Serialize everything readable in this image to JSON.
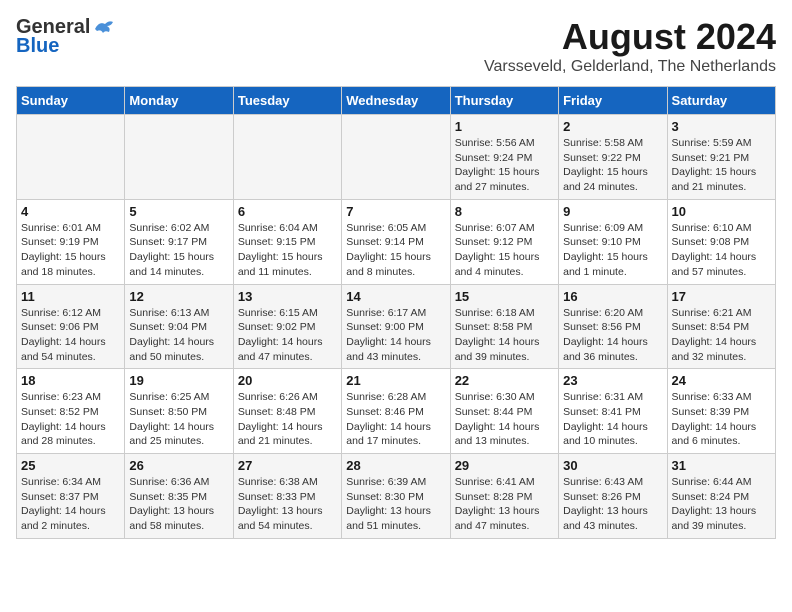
{
  "logo": {
    "general": "General",
    "blue": "Blue"
  },
  "title": "August 2024",
  "subtitle": "Varsseveld, Gelderland, The Netherlands",
  "days_of_week": [
    "Sunday",
    "Monday",
    "Tuesday",
    "Wednesday",
    "Thursday",
    "Friday",
    "Saturday"
  ],
  "weeks": [
    [
      {
        "day": "",
        "info": ""
      },
      {
        "day": "",
        "info": ""
      },
      {
        "day": "",
        "info": ""
      },
      {
        "day": "",
        "info": ""
      },
      {
        "day": "1",
        "info": "Sunrise: 5:56 AM\nSunset: 9:24 PM\nDaylight: 15 hours and 27 minutes."
      },
      {
        "day": "2",
        "info": "Sunrise: 5:58 AM\nSunset: 9:22 PM\nDaylight: 15 hours and 24 minutes."
      },
      {
        "day": "3",
        "info": "Sunrise: 5:59 AM\nSunset: 9:21 PM\nDaylight: 15 hours and 21 minutes."
      }
    ],
    [
      {
        "day": "4",
        "info": "Sunrise: 6:01 AM\nSunset: 9:19 PM\nDaylight: 15 hours and 18 minutes."
      },
      {
        "day": "5",
        "info": "Sunrise: 6:02 AM\nSunset: 9:17 PM\nDaylight: 15 hours and 14 minutes."
      },
      {
        "day": "6",
        "info": "Sunrise: 6:04 AM\nSunset: 9:15 PM\nDaylight: 15 hours and 11 minutes."
      },
      {
        "day": "7",
        "info": "Sunrise: 6:05 AM\nSunset: 9:14 PM\nDaylight: 15 hours and 8 minutes."
      },
      {
        "day": "8",
        "info": "Sunrise: 6:07 AM\nSunset: 9:12 PM\nDaylight: 15 hours and 4 minutes."
      },
      {
        "day": "9",
        "info": "Sunrise: 6:09 AM\nSunset: 9:10 PM\nDaylight: 15 hours and 1 minute."
      },
      {
        "day": "10",
        "info": "Sunrise: 6:10 AM\nSunset: 9:08 PM\nDaylight: 14 hours and 57 minutes."
      }
    ],
    [
      {
        "day": "11",
        "info": "Sunrise: 6:12 AM\nSunset: 9:06 PM\nDaylight: 14 hours and 54 minutes."
      },
      {
        "day": "12",
        "info": "Sunrise: 6:13 AM\nSunset: 9:04 PM\nDaylight: 14 hours and 50 minutes."
      },
      {
        "day": "13",
        "info": "Sunrise: 6:15 AM\nSunset: 9:02 PM\nDaylight: 14 hours and 47 minutes."
      },
      {
        "day": "14",
        "info": "Sunrise: 6:17 AM\nSunset: 9:00 PM\nDaylight: 14 hours and 43 minutes."
      },
      {
        "day": "15",
        "info": "Sunrise: 6:18 AM\nSunset: 8:58 PM\nDaylight: 14 hours and 39 minutes."
      },
      {
        "day": "16",
        "info": "Sunrise: 6:20 AM\nSunset: 8:56 PM\nDaylight: 14 hours and 36 minutes."
      },
      {
        "day": "17",
        "info": "Sunrise: 6:21 AM\nSunset: 8:54 PM\nDaylight: 14 hours and 32 minutes."
      }
    ],
    [
      {
        "day": "18",
        "info": "Sunrise: 6:23 AM\nSunset: 8:52 PM\nDaylight: 14 hours and 28 minutes."
      },
      {
        "day": "19",
        "info": "Sunrise: 6:25 AM\nSunset: 8:50 PM\nDaylight: 14 hours and 25 minutes."
      },
      {
        "day": "20",
        "info": "Sunrise: 6:26 AM\nSunset: 8:48 PM\nDaylight: 14 hours and 21 minutes."
      },
      {
        "day": "21",
        "info": "Sunrise: 6:28 AM\nSunset: 8:46 PM\nDaylight: 14 hours and 17 minutes."
      },
      {
        "day": "22",
        "info": "Sunrise: 6:30 AM\nSunset: 8:44 PM\nDaylight: 14 hours and 13 minutes."
      },
      {
        "day": "23",
        "info": "Sunrise: 6:31 AM\nSunset: 8:41 PM\nDaylight: 14 hours and 10 minutes."
      },
      {
        "day": "24",
        "info": "Sunrise: 6:33 AM\nSunset: 8:39 PM\nDaylight: 14 hours and 6 minutes."
      }
    ],
    [
      {
        "day": "25",
        "info": "Sunrise: 6:34 AM\nSunset: 8:37 PM\nDaylight: 14 hours and 2 minutes."
      },
      {
        "day": "26",
        "info": "Sunrise: 6:36 AM\nSunset: 8:35 PM\nDaylight: 13 hours and 58 minutes."
      },
      {
        "day": "27",
        "info": "Sunrise: 6:38 AM\nSunset: 8:33 PM\nDaylight: 13 hours and 54 minutes."
      },
      {
        "day": "28",
        "info": "Sunrise: 6:39 AM\nSunset: 8:30 PM\nDaylight: 13 hours and 51 minutes."
      },
      {
        "day": "29",
        "info": "Sunrise: 6:41 AM\nSunset: 8:28 PM\nDaylight: 13 hours and 47 minutes."
      },
      {
        "day": "30",
        "info": "Sunrise: 6:43 AM\nSunset: 8:26 PM\nDaylight: 13 hours and 43 minutes."
      },
      {
        "day": "31",
        "info": "Sunrise: 6:44 AM\nSunset: 8:24 PM\nDaylight: 13 hours and 39 minutes."
      }
    ]
  ]
}
